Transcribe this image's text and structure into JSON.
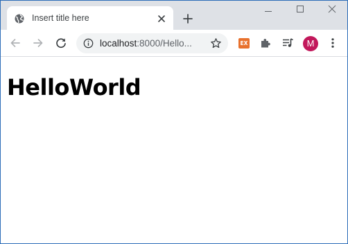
{
  "tab": {
    "title": "Insert title here"
  },
  "omnibox": {
    "url_host": "localhost",
    "url_path": ":8000/Hello..."
  },
  "extensions": {
    "ex_label": "EX"
  },
  "profile": {
    "initial": "M",
    "color": "#c2185b"
  },
  "page": {
    "heading": "HelloWorld"
  },
  "colors": {
    "tab_strip": "#dee1e6",
    "omnibox_bg": "#f1f3f4",
    "ext_ex": "#e8712d",
    "window_border": "#2b6cb8"
  },
  "icons": {
    "tab": "globe-icon",
    "tab_close": "close-icon",
    "new_tab": "plus-icon",
    "back": "arrow-left-icon",
    "forward": "arrow-right-icon",
    "reload": "reload-icon",
    "site_info": "info-icon",
    "bookmark": "star-icon",
    "extensions": "puzzle-icon",
    "media": "media-queue-icon",
    "menu": "kebab-menu-icon"
  }
}
